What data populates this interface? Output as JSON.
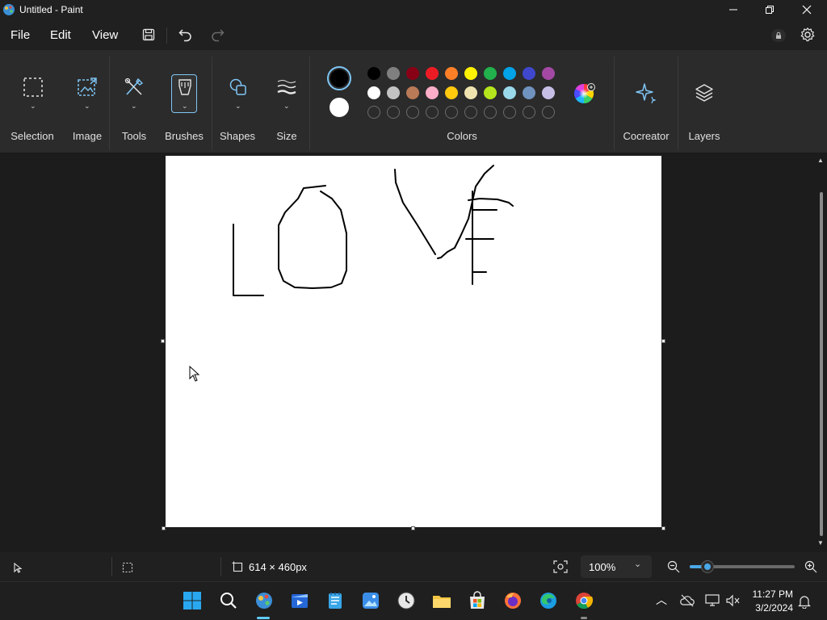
{
  "window": {
    "title": "Untitled - Paint"
  },
  "menu": {
    "file": "File",
    "edit": "Edit",
    "view": "View"
  },
  "ribbon": {
    "selection": "Selection",
    "image": "Image",
    "tools": "Tools",
    "brushes": "Brushes",
    "shapes": "Shapes",
    "size": "Size",
    "colors": "Colors",
    "cocreator": "Cocreator",
    "layers": "Layers"
  },
  "colors": {
    "primary": "#000000",
    "secondary": "#ffffff",
    "row1": [
      "#000000",
      "#7f7f7f",
      "#880015",
      "#ed1c24",
      "#ff7f27",
      "#fff200",
      "#22b14c",
      "#00a2e8",
      "#3f48cc",
      "#a349a4"
    ],
    "row2": [
      "#ffffff",
      "#c3c3c3",
      "#b97a57",
      "#ffaec9",
      "#ffc90e",
      "#efe4b0",
      "#b5e61d",
      "#99d9ea",
      "#7092be",
      "#c8bfe7"
    ],
    "row3_empty_count": 10
  },
  "status": {
    "canvas_size": "614 × 460px",
    "zoom": "100%"
  },
  "zoom_slider_fraction": 0.17,
  "taskbar": {
    "time": "11:27 PM",
    "date": "3/2/2024"
  }
}
